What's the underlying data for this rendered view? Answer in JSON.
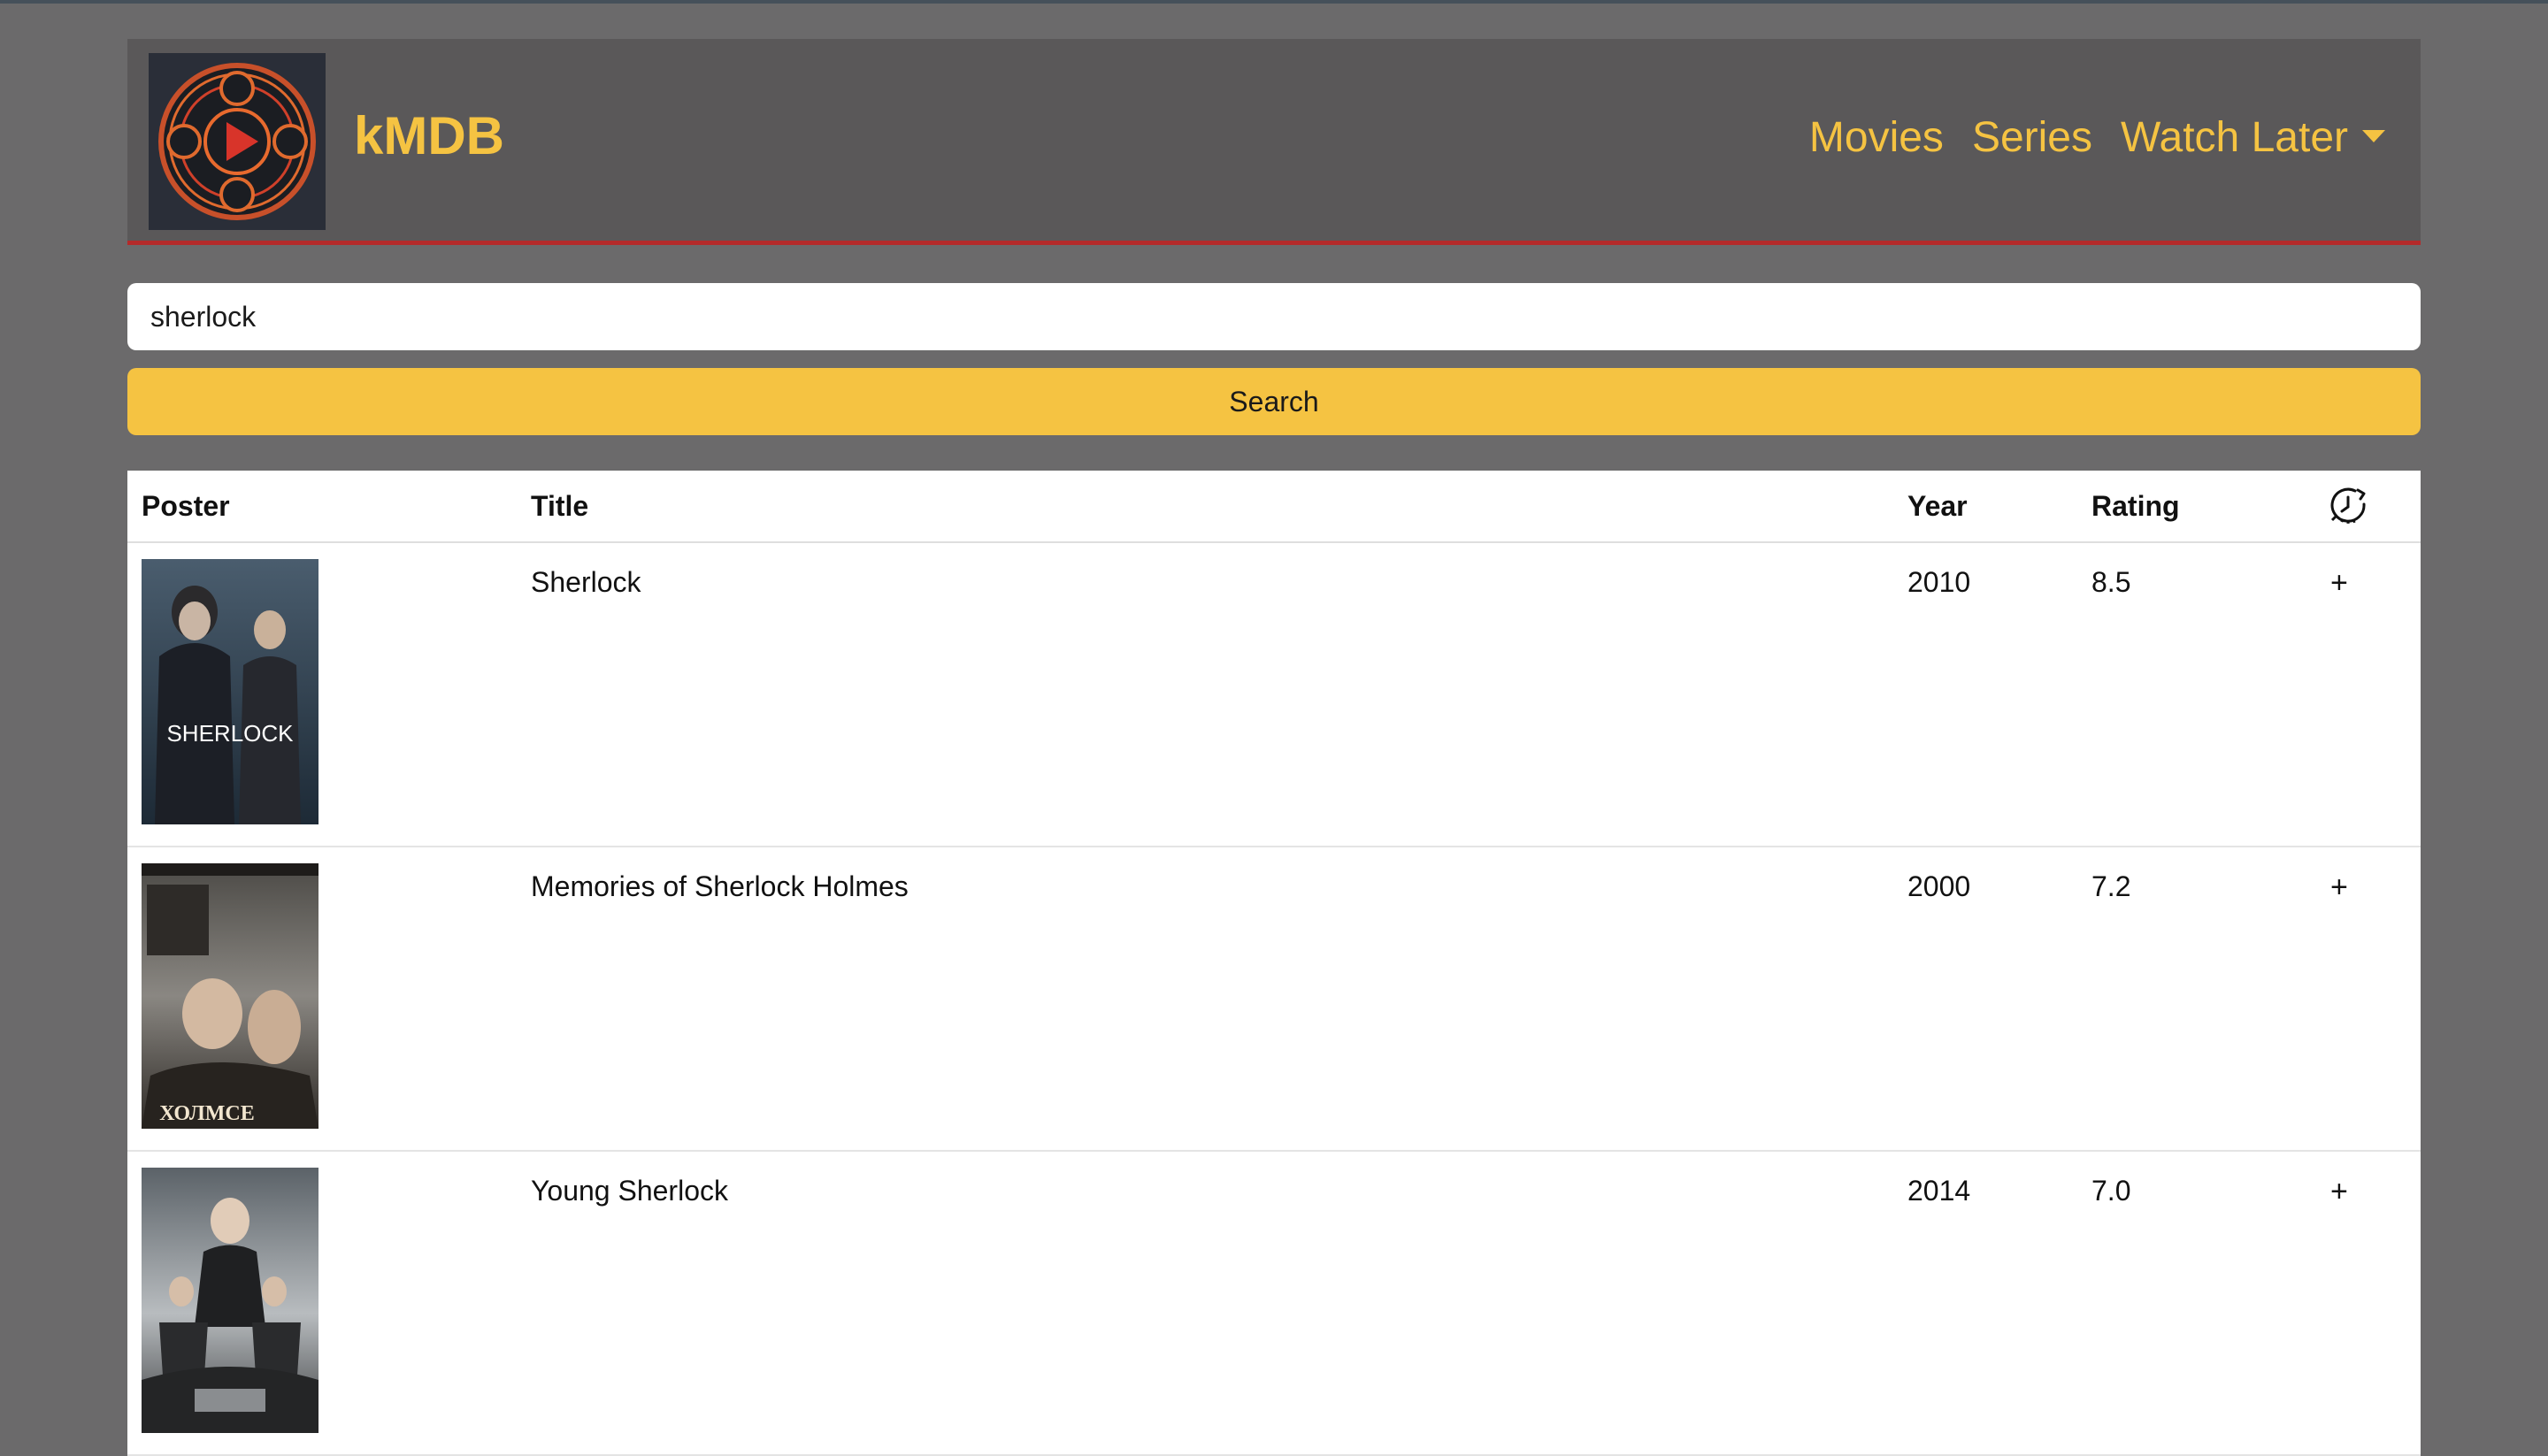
{
  "header": {
    "brand": "kMDB",
    "nav": {
      "movies": "Movies",
      "series": "Series",
      "watch_later": "Watch Later"
    }
  },
  "search": {
    "value": "sherlock",
    "button_label": "Search"
  },
  "table": {
    "columns": {
      "poster": "Poster",
      "title": "Title",
      "year": "Year",
      "rating": "Rating",
      "watch_later_icon": "clock-refresh-icon"
    },
    "rows": [
      {
        "poster_text": "SHERLOCK",
        "title": "Sherlock",
        "year": "2010",
        "rating": "8.5",
        "action": "+"
      },
      {
        "poster_text": "ХОЛМСЕ",
        "title": "Memories of Sherlock Holmes",
        "year": "2000",
        "rating": "7.2",
        "action": "+"
      },
      {
        "poster_text": "",
        "title": "Young Sherlock",
        "year": "2014",
        "rating": "7.0",
        "action": "+"
      }
    ]
  },
  "colors": {
    "accent": "#f5c342",
    "header_bg": "#5a5859",
    "header_border": "#b42a2a",
    "page_bg": "#6b6a6b"
  }
}
